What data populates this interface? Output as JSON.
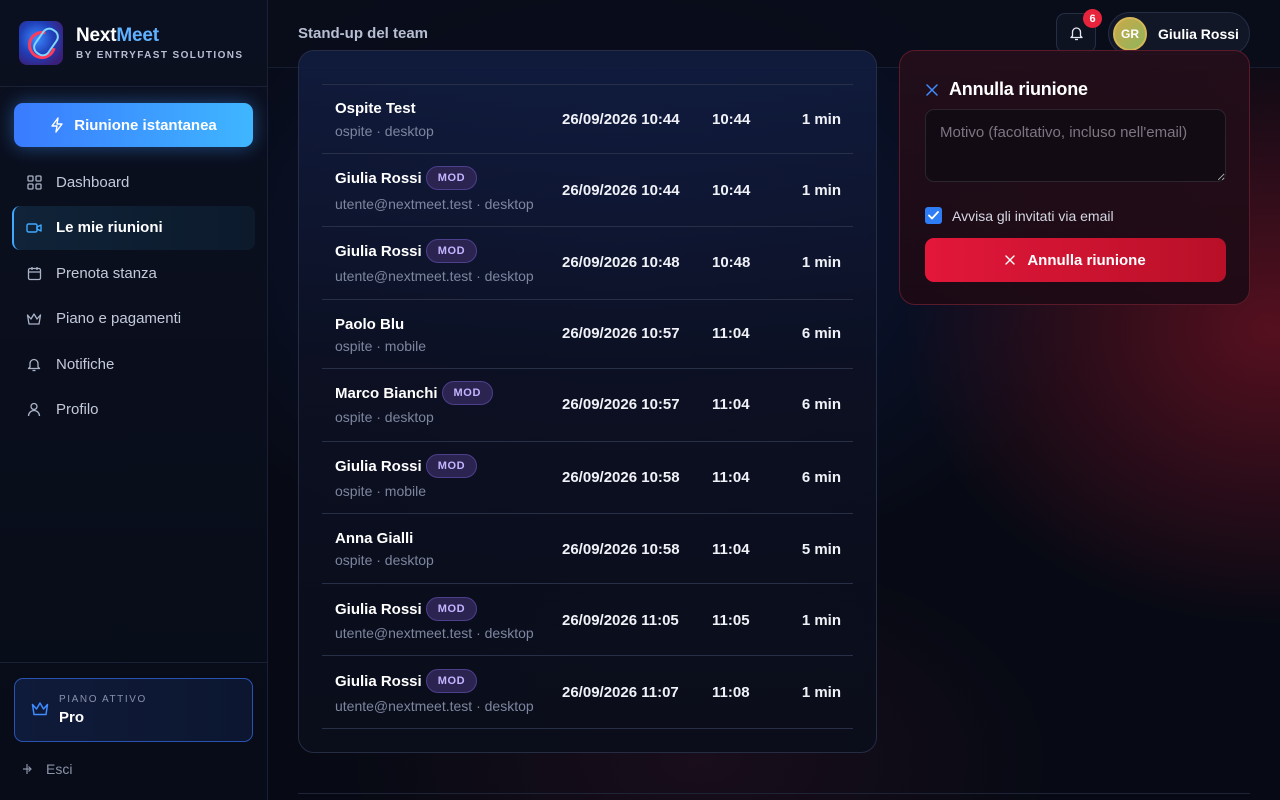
{
  "app": {
    "name_part1": "Next",
    "name_part2": "Meet",
    "subtitle": "BY ENTRYFAST SOLUTIONS"
  },
  "sidebar": {
    "instant_meeting_label": "Riunione istantanea",
    "items": [
      {
        "label": "Dashboard",
        "icon": "grid-icon",
        "active": false
      },
      {
        "label": "Le mie riunioni",
        "icon": "video-icon",
        "active": true
      },
      {
        "label": "Prenota stanza",
        "icon": "calendar-icon",
        "active": false
      },
      {
        "label": "Piano e pagamenti",
        "icon": "crown-icon",
        "active": false
      },
      {
        "label": "Notifiche",
        "icon": "bell-icon",
        "active": false
      },
      {
        "label": "Profilo",
        "icon": "user-icon",
        "active": false
      }
    ],
    "plan": {
      "label": "PIANO ATTIVO",
      "value": "Pro"
    },
    "logout_label": "Esci"
  },
  "header": {
    "title": "Stand-up del team",
    "notifications_count": "6",
    "user": {
      "initials": "GR",
      "name": "Giulia Rossi"
    }
  },
  "attendance": {
    "rows": [
      {
        "name": "Ospite Test",
        "mod": false,
        "sub": "ospite · desktop",
        "joined": "26/09/2026 10:44",
        "left": "10:44",
        "duration": "1 min"
      },
      {
        "name": "Giulia Rossi",
        "mod": true,
        "sub": "utente@nextmeet.test · desktop",
        "joined": "26/09/2026 10:44",
        "left": "10:44",
        "duration": "1 min"
      },
      {
        "name": "Giulia Rossi",
        "mod": true,
        "sub": "utente@nextmeet.test · desktop",
        "joined": "26/09/2026 10:48",
        "left": "10:48",
        "duration": "1 min"
      },
      {
        "name": "Paolo Blu",
        "mod": false,
        "sub": "ospite · mobile",
        "joined": "26/09/2026 10:57",
        "left": "11:04",
        "duration": "6 min"
      },
      {
        "name": "Marco Bianchi",
        "mod": true,
        "sub": "ospite · desktop",
        "joined": "26/09/2026 10:57",
        "left": "11:04",
        "duration": "6 min"
      },
      {
        "name": "Giulia Rossi",
        "mod": true,
        "sub": "ospite · mobile",
        "joined": "26/09/2026 10:58",
        "left": "11:04",
        "duration": "6 min"
      },
      {
        "name": "Anna Gialli",
        "mod": false,
        "sub": "ospite · desktop",
        "joined": "26/09/2026 10:58",
        "left": "11:04",
        "duration": "5 min"
      },
      {
        "name": "Giulia Rossi",
        "mod": true,
        "sub": "utente@nextmeet.test · desktop",
        "joined": "26/09/2026 11:05",
        "left": "11:05",
        "duration": "1 min"
      },
      {
        "name": "Giulia Rossi",
        "mod": true,
        "sub": "utente@nextmeet.test · desktop",
        "joined": "26/09/2026 11:07",
        "left": "11:08",
        "duration": "1 min"
      }
    ],
    "mod_badge_label": "MOD"
  },
  "cancel": {
    "title": "Annulla riunione",
    "reason_placeholder": "Motivo (facoltativo, incluso nell'email)",
    "reason_value": "",
    "notify_label": "Avvisa gli invitati via email",
    "notify_checked": true,
    "button_label": "Annulla riunione"
  },
  "colors": {
    "accent_blue": "#3fa8ff",
    "danger_red": "#e3173a",
    "mod_purple": "#c4b4ff"
  }
}
